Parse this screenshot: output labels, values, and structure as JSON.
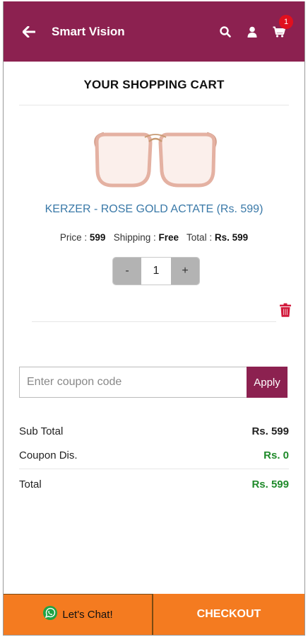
{
  "header": {
    "title": "Smart Vision",
    "cart_count": "1",
    "icons": [
      "back-arrow-icon",
      "search-icon",
      "user-icon",
      "cart-icon"
    ],
    "background": "#8c2150"
  },
  "cart": {
    "heading": "YOUR SHOPPING CART",
    "product": {
      "name": "KERZER - ROSE GOLD ACTATE (Rs. 599)",
      "price_label": "Price :",
      "price": "599",
      "shipping_label": "Shipping :",
      "shipping": "Free",
      "total_label": "Total :",
      "total": "Rs. 599"
    },
    "quantity": {
      "minus": "-",
      "value": "1",
      "plus": "+"
    }
  },
  "coupon": {
    "placeholder": "Enter coupon code",
    "apply_label": "Apply"
  },
  "summary": {
    "subtotal_label": "Sub Total",
    "subtotal": "Rs. 599",
    "discount_label": "Coupon Dis.",
    "discount": "Rs. 0",
    "total_label": "Total",
    "total": "Rs. 599"
  },
  "footer": {
    "chat_label": "Let's Chat!",
    "checkout_label": "CHECKOUT",
    "accent": "#f47b20"
  }
}
